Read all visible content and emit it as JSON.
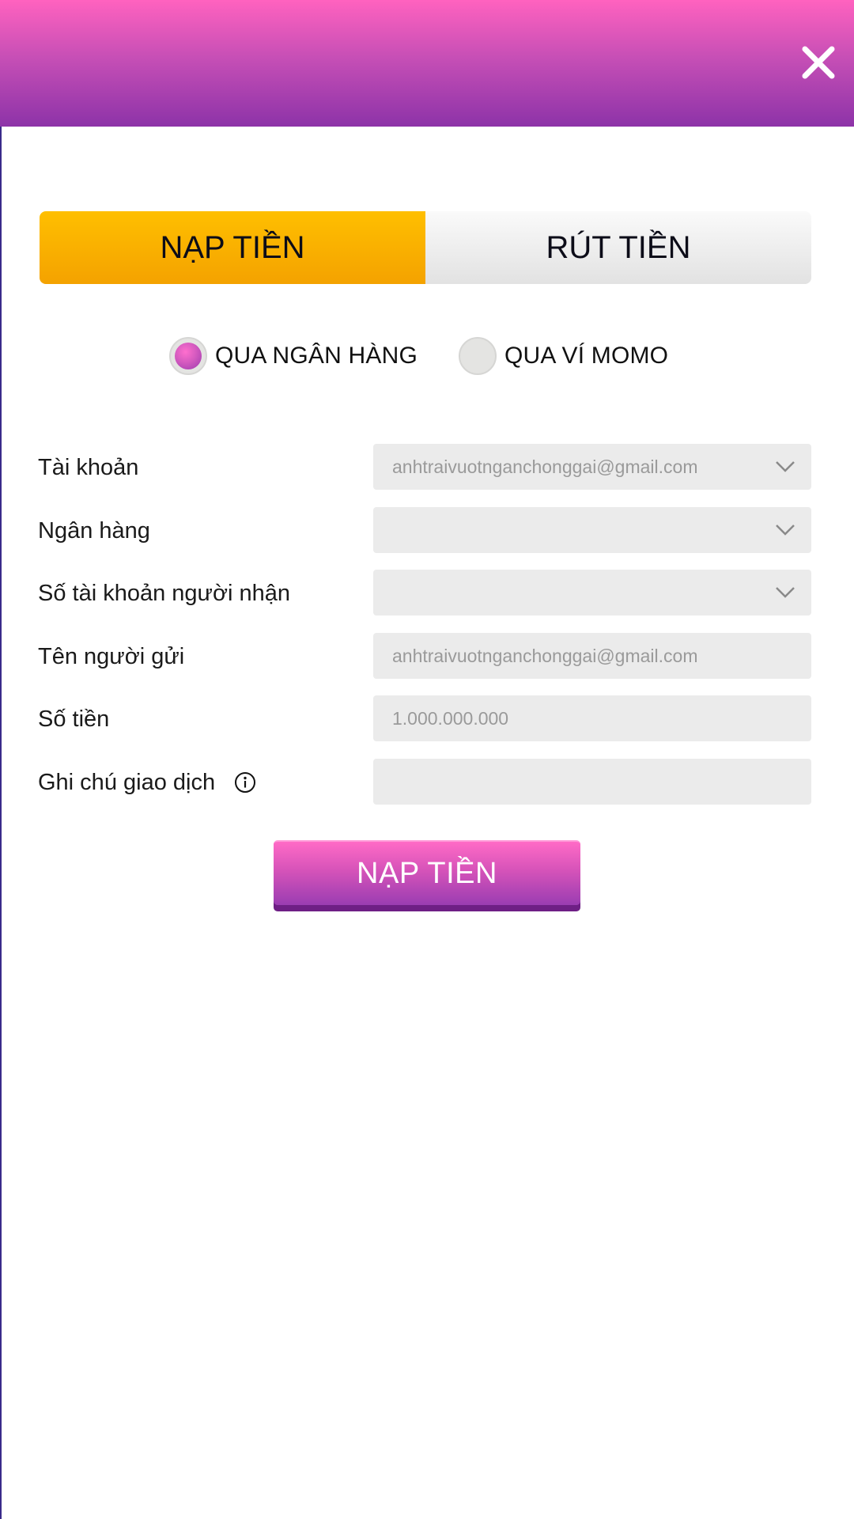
{
  "header": {
    "close_icon": "close-icon"
  },
  "tabs": [
    {
      "label": "NẠP TIỀN",
      "active": true
    },
    {
      "label": "RÚT TIỀN",
      "active": false
    }
  ],
  "payment_methods": [
    {
      "label": "QUA NGÂN HÀNG",
      "selected": true
    },
    {
      "label": "QUA VÍ MOMO",
      "selected": false
    }
  ],
  "form": {
    "account": {
      "label": "Tài khoản",
      "value": "anhtraivuotnganchonggai@gmail.com"
    },
    "bank": {
      "label": "Ngân hàng",
      "value": ""
    },
    "recipient_account": {
      "label": "Số tài khoản người nhận",
      "value": ""
    },
    "sender_name": {
      "label": "Tên người gửi",
      "placeholder": "anhtraivuotnganchonggai@gmail.com"
    },
    "amount": {
      "label": "Số tiền",
      "placeholder": "1.000.000.000"
    },
    "note": {
      "label": "Ghi chú giao dịch",
      "placeholder": ""
    }
  },
  "submit": {
    "label": "NẠP TIỀN"
  },
  "colors": {
    "header_top": "#ff62bf",
    "header_bottom": "#8d33a8",
    "active_tab": "#ffbf00",
    "inactive_tab": "#e8e8e8",
    "field_bg": "#ebebeb",
    "button_pink": "#ff6bc6",
    "button_purple": "#9a3db2"
  }
}
